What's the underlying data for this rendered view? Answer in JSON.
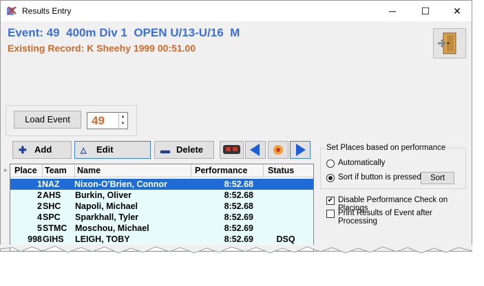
{
  "window": {
    "title": "Results Entry",
    "minimize": "─",
    "maximize": "☐",
    "close": "✕"
  },
  "event": {
    "title": "Event: 49  400m Div 1  OPEN U/13-U/16  M",
    "record": "Existing Record: K Sheehy 1999 00:51.00"
  },
  "load": {
    "button_label": "Load Event",
    "event_number": "49"
  },
  "toolbar": {
    "add_label": "Add",
    "edit_label": "Edit",
    "delete_label": "Delete"
  },
  "grid": {
    "gutter_marker": "»",
    "columns": [
      "Place",
      "Team",
      "Name",
      "Performance",
      "Status"
    ],
    "rows": [
      {
        "place": "1",
        "team": "NAZ",
        "name": "Nixon-O'Brien, Connor",
        "performance": "8:52.68",
        "status": ""
      },
      {
        "place": "2",
        "team": "AHS",
        "name": "Burkin, Oliver",
        "performance": "8:52.68",
        "status": ""
      },
      {
        "place": "2",
        "team": "SHC",
        "name": "Napoli, Michael",
        "performance": "8:52.68",
        "status": ""
      },
      {
        "place": "4",
        "team": "SPC",
        "name": "Sparkhall, Tyler",
        "performance": "8:52.69",
        "status": ""
      },
      {
        "place": "5",
        "team": "STMC",
        "name": "Moschou, Michael",
        "performance": "8:52.69",
        "status": ""
      },
      {
        "place": "998",
        "team": "GIHS",
        "name": "LEIGH, TOBY",
        "performance": "8:52.69",
        "status": "DSQ"
      }
    ]
  },
  "places_group": {
    "title": "Set Places based on performance",
    "option_auto": "Automatically",
    "option_sort": "Sort if button is pressed:",
    "selected": "sort",
    "sort_button": "Sort"
  },
  "options": {
    "disable_check_label": "Disable Performance Check on Placings",
    "disable_check_checked": true,
    "print_results_label": "Print Results of Event after Processing",
    "print_results_checked": false
  },
  "colors": {
    "event_title": "#3d6fd8",
    "record": "#cc6b2e",
    "selection": "#1f6cd6",
    "row_background": "#e7fbfb"
  }
}
